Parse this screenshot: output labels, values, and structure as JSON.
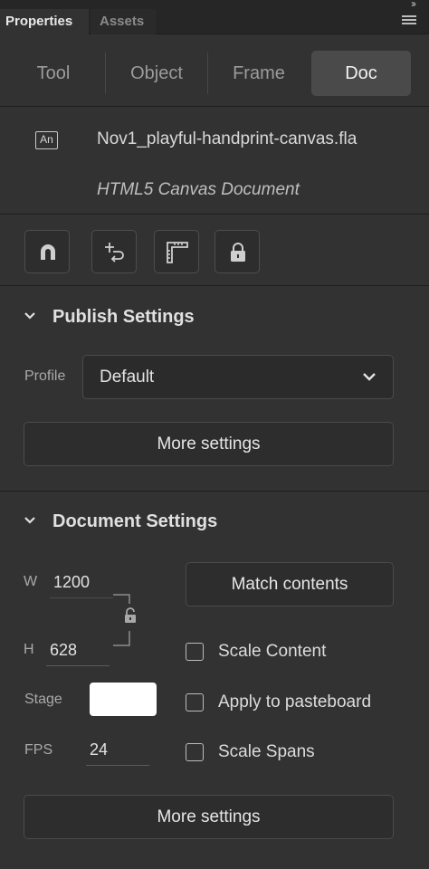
{
  "panel_tabs": {
    "properties": "Properties",
    "assets": "Assets",
    "collapse": "››"
  },
  "seg_tabs": {
    "tool": "Tool",
    "object": "Object",
    "frame": "Frame",
    "doc": "Doc"
  },
  "document": {
    "icon_text": "An",
    "file_name": "Nov1_playful-handprint-canvas.fla",
    "doc_type": "HTML5 Canvas Document"
  },
  "toolbar_icons": [
    "snap-magnet-icon",
    "pin-transform-icon",
    "ruler-icon",
    "lock-icon"
  ],
  "publish": {
    "title": "Publish Settings",
    "profile_label": "Profile",
    "profile_value": "Default",
    "more_settings": "More settings"
  },
  "doc_settings": {
    "title": "Document Settings",
    "w_label": "W",
    "w_value": "1200",
    "h_label": "H",
    "h_value": "628",
    "match_contents": "Match contents",
    "stage_label": "Stage",
    "stage_color": "#ffffff",
    "fps_label": "FPS",
    "fps_value": "24",
    "scale_content": "Scale Content",
    "apply_pasteboard": "Apply to pasteboard",
    "scale_spans": "Scale Spans",
    "more_settings": "More settings"
  }
}
